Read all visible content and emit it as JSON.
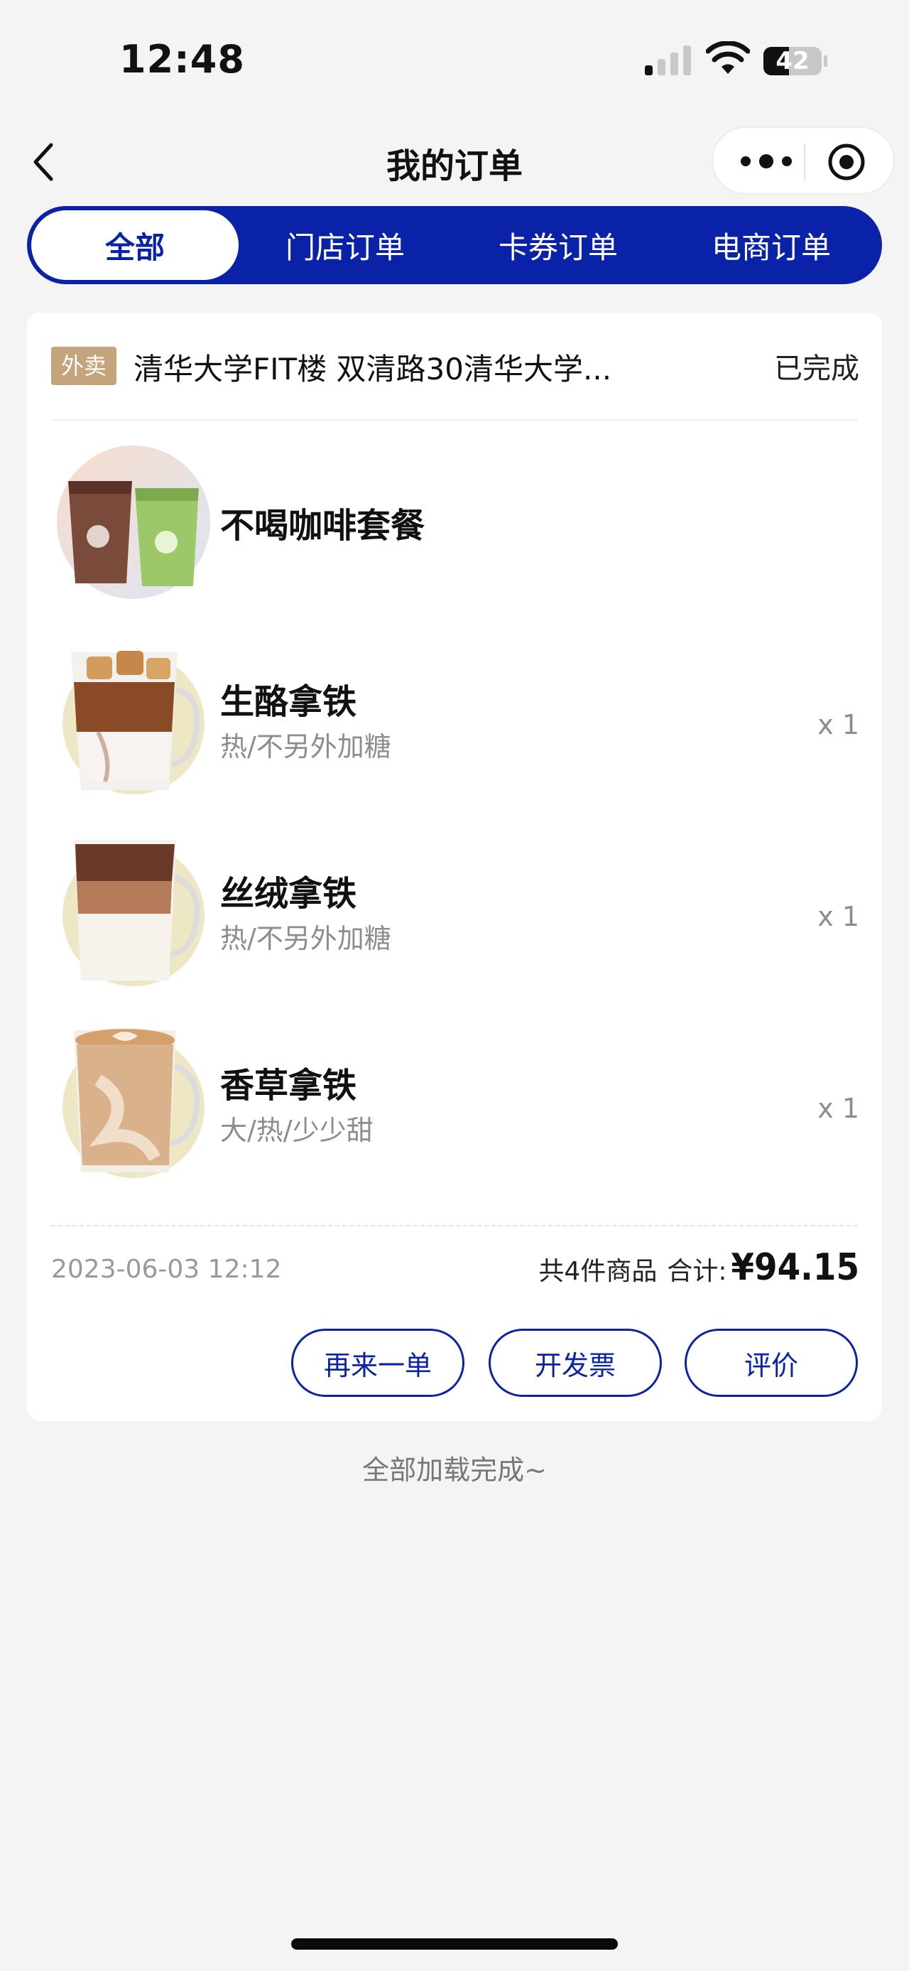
{
  "status_bar": {
    "time": "12:48",
    "battery": "42"
  },
  "nav": {
    "title": "我的订单"
  },
  "tabs": [
    {
      "label": "全部",
      "active": true
    },
    {
      "label": "门店订单",
      "active": false
    },
    {
      "label": "卡券订单",
      "active": false
    },
    {
      "label": "电商订单",
      "active": false
    }
  ],
  "order": {
    "tag": "外卖",
    "address": "清华大学FIT楼 双清路30清华大学...",
    "status": "已完成",
    "items": [
      {
        "name": "不喝咖啡套餐",
        "spec": "",
        "qty": "",
        "icon": "combo-drinks-image"
      },
      {
        "name": "生酪拿铁",
        "spec": "热/不另外加糖",
        "qty": "x 1",
        "icon": "iced-latte-image"
      },
      {
        "name": "丝绒拿铁",
        "spec": "热/不另外加糖",
        "qty": "x 1",
        "icon": "velvet-latte-image"
      },
      {
        "name": "香草拿铁",
        "spec": "大/热/少少甜",
        "qty": "x 1",
        "icon": "vanilla-latte-image"
      }
    ],
    "time": "2023-06-03 12:12",
    "count_text": "共4件商品",
    "total_label": "合计:",
    "total_value": "¥94.15",
    "buttons": {
      "reorder": "再来一单",
      "invoice": "开发票",
      "review": "评价"
    }
  },
  "footer": {
    "load_complete": "全部加载完成~"
  },
  "colors": {
    "brand": "#0a22a8",
    "tag": "#c4a47a",
    "background": "#f4f4f4"
  }
}
